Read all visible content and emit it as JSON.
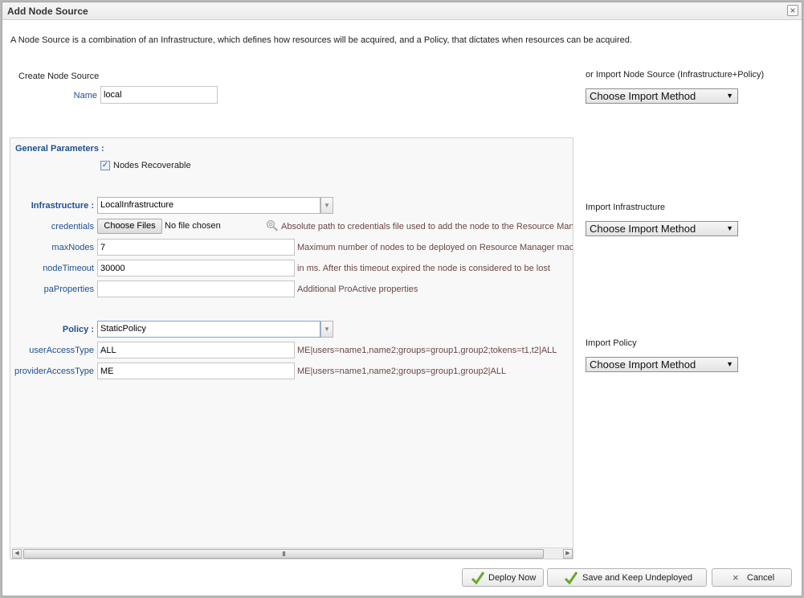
{
  "dialog": {
    "title": "Add Node Source",
    "close_icon": "close-icon",
    "intro": "A Node Source is a combination of an Infrastructure, which defines how resources will be acquired, and a Policy, that dictates when resources can be acquired."
  },
  "create": {
    "heading": "Create Node Source",
    "name_label": "Name",
    "name_value": "local"
  },
  "imports": {
    "node_source": {
      "title": "or Import Node Source (Infrastructure+Policy)",
      "selected": "Choose Import Method"
    },
    "infrastructure": {
      "title": "Import Infrastructure",
      "selected": "Choose Import Method"
    },
    "policy": {
      "title": "Import Policy",
      "selected": "Choose Import Method"
    }
  },
  "general": {
    "title": "General Parameters :",
    "nodes_recoverable_label": "Nodes Recoverable",
    "nodes_recoverable_checked": true
  },
  "infrastructure": {
    "label": "Infrastructure :",
    "selected": "LocalInfrastructure",
    "params": [
      {
        "label": "credentials",
        "button": "Choose Files",
        "status": "No file chosen",
        "hint": "Absolute path to credentials file used to add the node to the Resource Manager"
      },
      {
        "label": "maxNodes",
        "value": "7",
        "hint": "Maximum number of nodes to be deployed on Resource Manager machine"
      },
      {
        "label": "nodeTimeout",
        "value": "30000",
        "hint": "in ms. After this timeout expired the node is considered to be lost"
      },
      {
        "label": "paProperties",
        "value": "",
        "hint": "Additional ProActive properties"
      }
    ]
  },
  "policy": {
    "label": "Policy :",
    "selected": "StaticPolicy",
    "params": [
      {
        "label": "userAccessType",
        "value": "ALL",
        "hint": "ME|users=name1,name2;groups=group1,group2;tokens=t1,t2|ALL"
      },
      {
        "label": "providerAccessType",
        "value": "ME",
        "hint": "ME|users=name1,name2;groups=group1,group2|ALL"
      }
    ]
  },
  "scrollbar": {
    "grip": "III"
  },
  "footer": {
    "deploy": "Deploy Now",
    "save": "Save and Keep Undeployed",
    "cancel": "Cancel"
  }
}
